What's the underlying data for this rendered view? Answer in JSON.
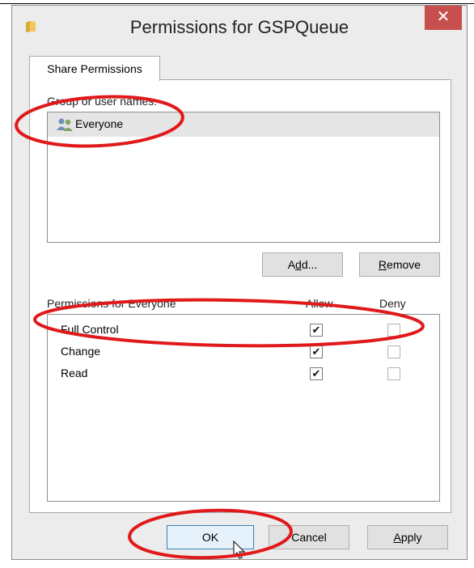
{
  "window": {
    "title": "Permissions for GSPQueue",
    "close_glyph": "✕"
  },
  "tabs": [
    {
      "label": "Share Permissions",
      "active": true
    }
  ],
  "users_section": {
    "label": "Group or user names:",
    "items": [
      {
        "label": "Everyone",
        "icon": "users-icon",
        "selected": true
      }
    ],
    "add_label_pre": "A",
    "add_label_key": "d",
    "add_label_post": "d...",
    "remove_label_key": "R",
    "remove_label_post": "emove"
  },
  "permissions_section": {
    "label": "Permissions for Everyone",
    "allow_header": "Allow",
    "deny_header": "Deny",
    "rows": [
      {
        "label": "Full Control",
        "allow": true,
        "deny": false
      },
      {
        "label": "Change",
        "allow": true,
        "deny": false
      },
      {
        "label": "Read",
        "allow": true,
        "deny": false
      }
    ],
    "check_glyph": "✔"
  },
  "footer": {
    "ok_label": "OK",
    "cancel_label": "Cancel",
    "apply_label_key": "A",
    "apply_label_post": "pply"
  },
  "colors": {
    "close_button": "#c7504e",
    "annotation": "#e0191b",
    "selection": "#e5e5e5"
  }
}
